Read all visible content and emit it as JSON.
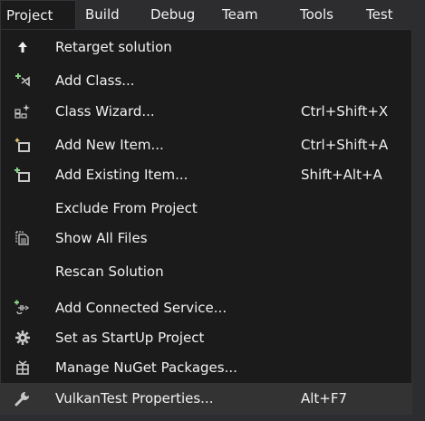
{
  "menubar": {
    "items": [
      {
        "label": "Project"
      },
      {
        "label": "Build"
      },
      {
        "label": "Debug"
      },
      {
        "label": "Team"
      },
      {
        "label": "Tools"
      },
      {
        "label": "Test"
      }
    ],
    "active_index": 0
  },
  "menu": {
    "items": [
      {
        "label": "Retarget solution",
        "shortcut": "",
        "icon": "up-arrow-icon"
      },
      {
        "label": "Add Class...",
        "shortcut": "",
        "icon": "add-class-icon"
      },
      {
        "label": "Class Wizard...",
        "shortcut": "Ctrl+Shift+X",
        "icon": "class-wizard-icon"
      },
      {
        "label": "Add New Item...",
        "shortcut": "Ctrl+Shift+A",
        "icon": "add-new-item-icon"
      },
      {
        "label": "Add Existing Item...",
        "shortcut": "Shift+Alt+A",
        "icon": "add-existing-item-icon"
      },
      {
        "label": "Exclude From Project",
        "shortcut": "",
        "icon": ""
      },
      {
        "label": "Show All Files",
        "shortcut": "",
        "icon": "show-all-files-icon"
      },
      {
        "label": "Rescan Solution",
        "shortcut": "",
        "icon": ""
      },
      {
        "label": "Add Connected Service...",
        "shortcut": "",
        "icon": "connected-service-icon"
      },
      {
        "label": "Set as StartUp Project",
        "shortcut": "",
        "icon": "gear-icon"
      },
      {
        "label": "Manage NuGet Packages...",
        "shortcut": "",
        "icon": "nuget-icon"
      },
      {
        "label": "VulkanTest Properties...",
        "shortcut": "Alt+F7",
        "icon": "wrench-icon"
      }
    ],
    "highlighted_index": 11
  },
  "colors": {
    "background": "#2d2d30",
    "menu_background": "#1b1b1c",
    "highlight": "#333334",
    "text": "#f1f1f1",
    "icon_accent": "#89d185"
  }
}
